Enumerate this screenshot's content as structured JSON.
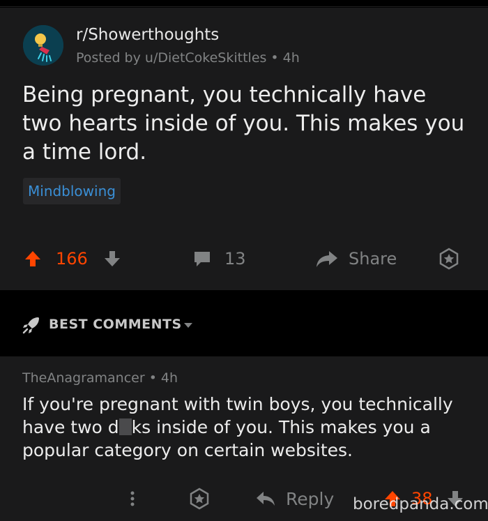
{
  "post": {
    "subreddit": "r/Showerthoughts",
    "posted_by_prefix": "Posted by",
    "author": "u/DietCokeSkittles",
    "age": "4h",
    "separator": "•",
    "title": "Being pregnant, you technically have two hearts inside of you. This makes you a time lord.",
    "flair": "Mindblowing",
    "score": "166",
    "comment_count": "13",
    "share_label": "Share"
  },
  "sort": {
    "label": "BEST COMMENTS"
  },
  "comment": {
    "author": "TheAnagramancer",
    "age": "4h",
    "separator": "•",
    "body_before_censor": "If you're pregnant with twin boys, you technically have two d",
    "body_after_censor": "ks inside of you. This makes you a popular category on certain websites.",
    "reply_label": "Reply",
    "score": "38"
  },
  "watermark": "boredpanda.com",
  "colors": {
    "background": "#1a1a1b",
    "upvote": "#ff4500",
    "flair_text": "#3a8fd6",
    "muted": "#818384"
  }
}
